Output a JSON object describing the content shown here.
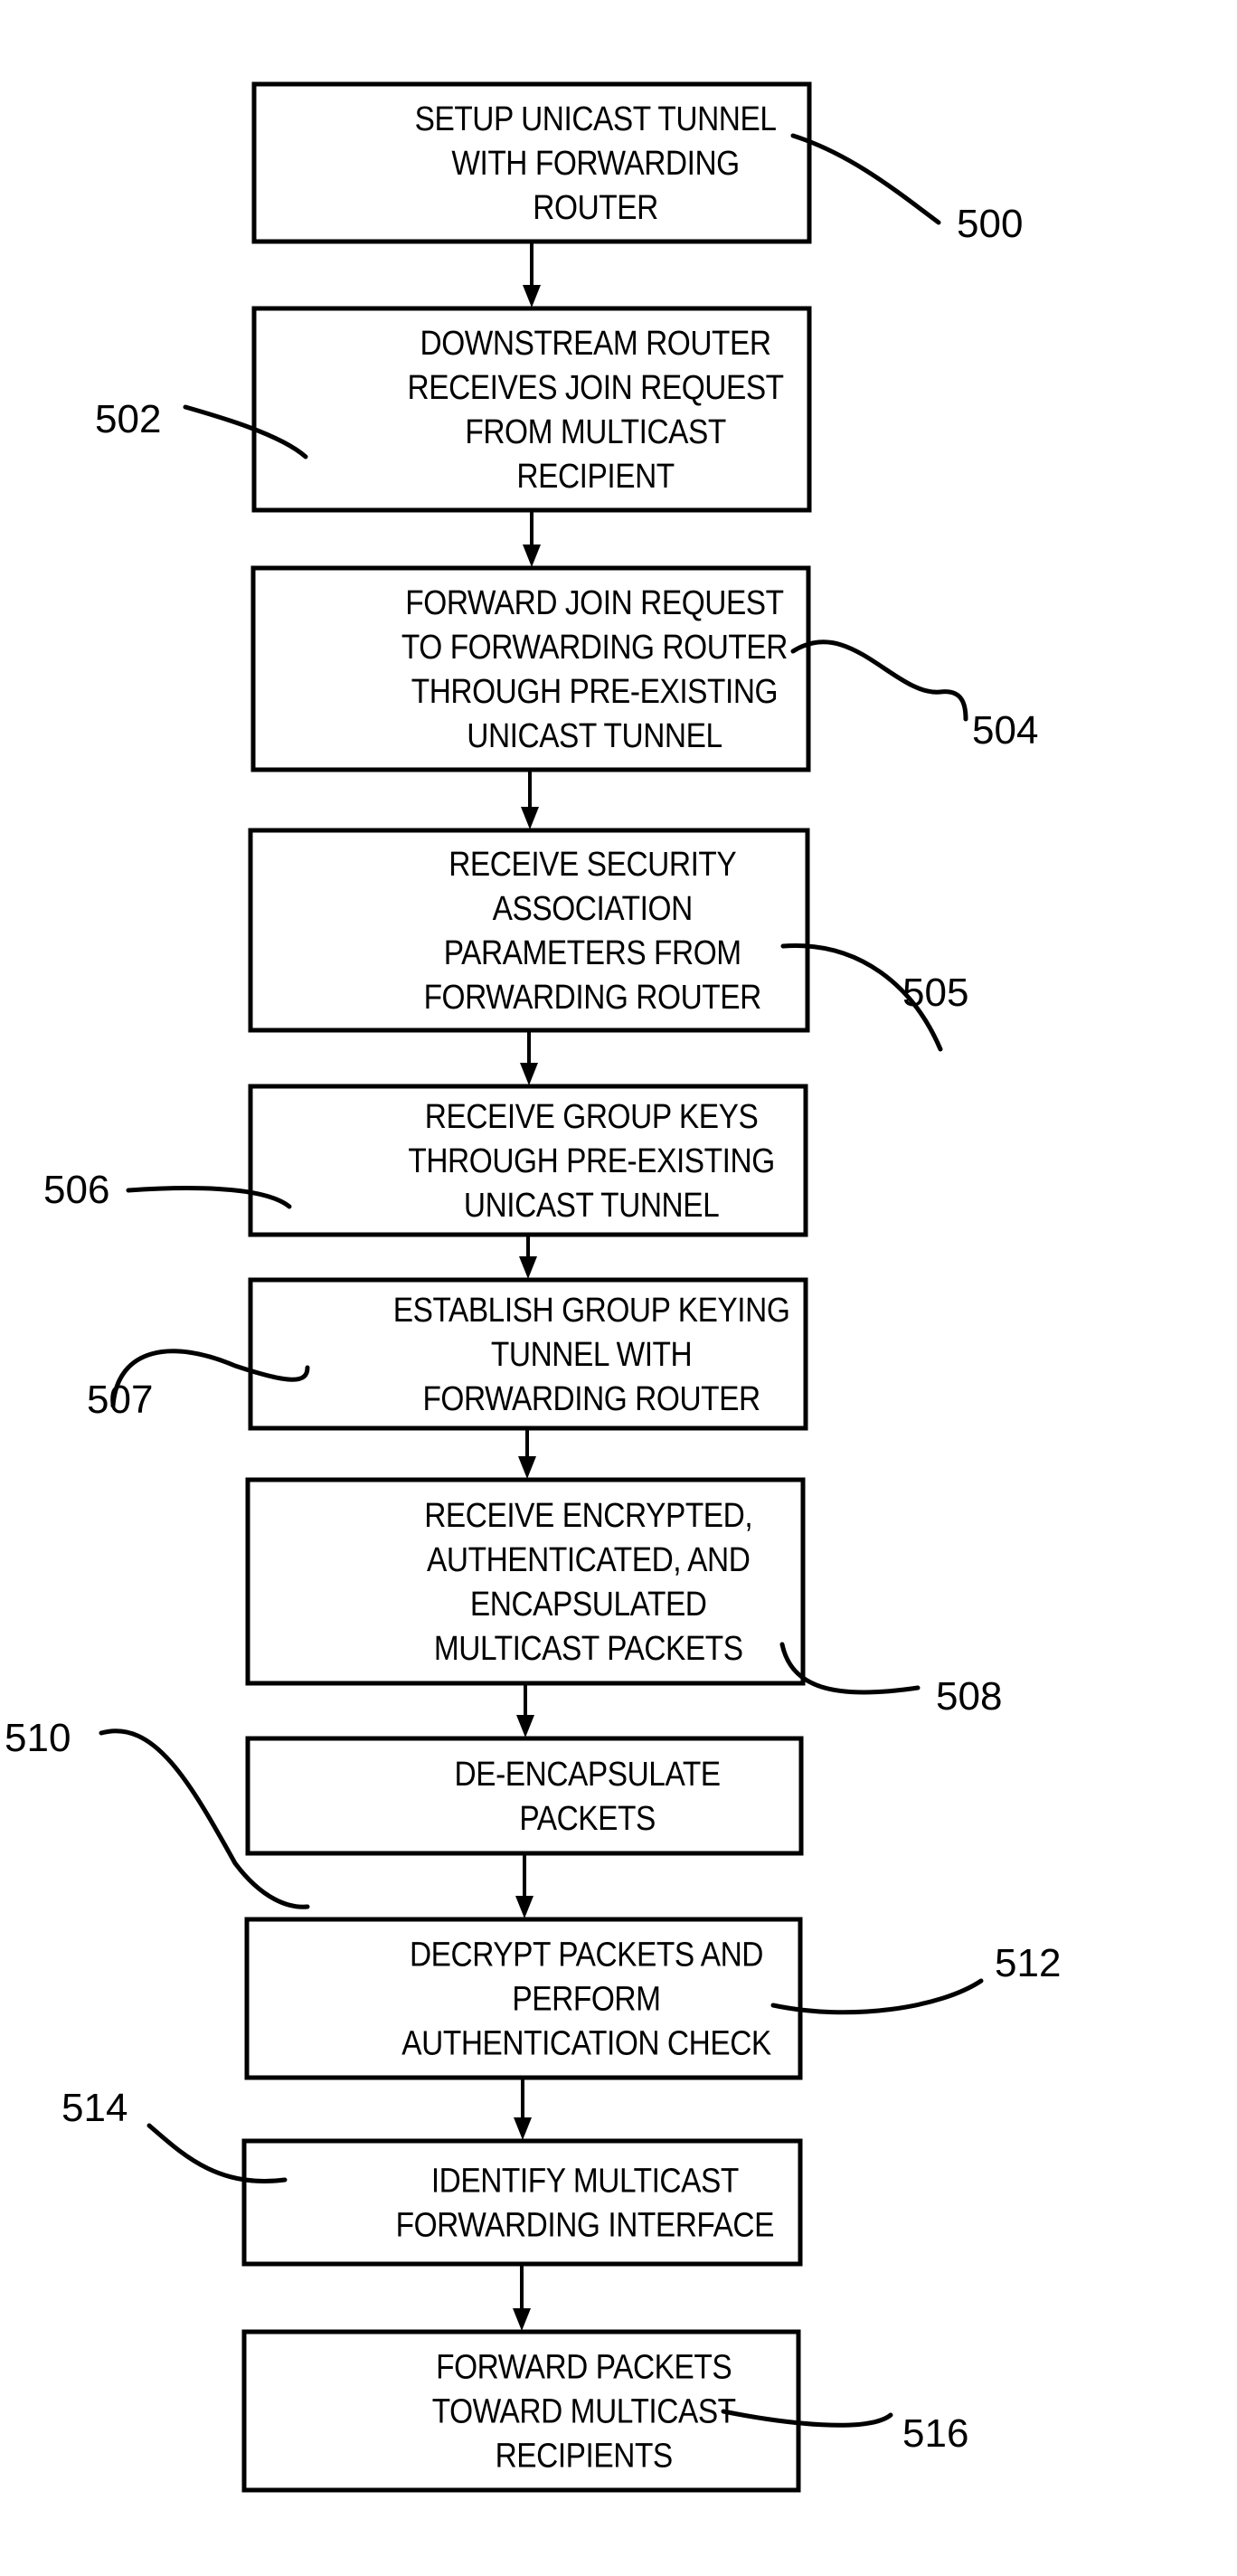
{
  "figure": {
    "type": "flowchart",
    "steps": [
      {
        "ref": "500",
        "lines": [
          "SETUP UNICAST TUNNEL",
          "WITH FORWARDING",
          "ROUTER"
        ]
      },
      {
        "ref": "502",
        "lines": [
          "DOWNSTREAM ROUTER",
          "RECEIVES JOIN REQUEST",
          "FROM MULTICAST",
          "RECIPIENT"
        ]
      },
      {
        "ref": "504",
        "lines": [
          "FORWARD JOIN REQUEST",
          "TO FORWARDING ROUTER",
          "THROUGH PRE-EXISTING",
          "UNICAST TUNNEL"
        ]
      },
      {
        "ref": "505",
        "lines": [
          "RECEIVE SECURITY",
          "ASSOCIATION",
          "PARAMETERS FROM",
          "FORWARDING ROUTER"
        ]
      },
      {
        "ref": "506",
        "lines": [
          "RECEIVE GROUP KEYS",
          "THROUGH PRE-EXISTING",
          "UNICAST TUNNEL"
        ]
      },
      {
        "ref": "507",
        "lines": [
          "ESTABLISH GROUP KEYING",
          "TUNNEL WITH",
          "FORWARDING ROUTER"
        ]
      },
      {
        "ref": "508",
        "lines": [
          "RECEIVE ENCRYPTED,",
          "AUTHENTICATED, AND",
          "ENCAPSULATED",
          "MULTICAST PACKETS"
        ]
      },
      {
        "ref": "510",
        "lines": [
          "DE-ENCAPSULATE",
          "PACKETS"
        ]
      },
      {
        "ref": "512",
        "lines": [
          "DECRYPT PACKETS AND",
          "PERFORM",
          "AUTHENTICATION CHECK"
        ]
      },
      {
        "ref": "514",
        "lines": [
          "IDENTIFY MULTICAST",
          "FORWARDING INTERFACE"
        ]
      },
      {
        "ref": "516",
        "lines": [
          "FORWARD PACKETS",
          "TOWARD MULTICAST",
          "RECIPIENTS"
        ]
      }
    ]
  }
}
